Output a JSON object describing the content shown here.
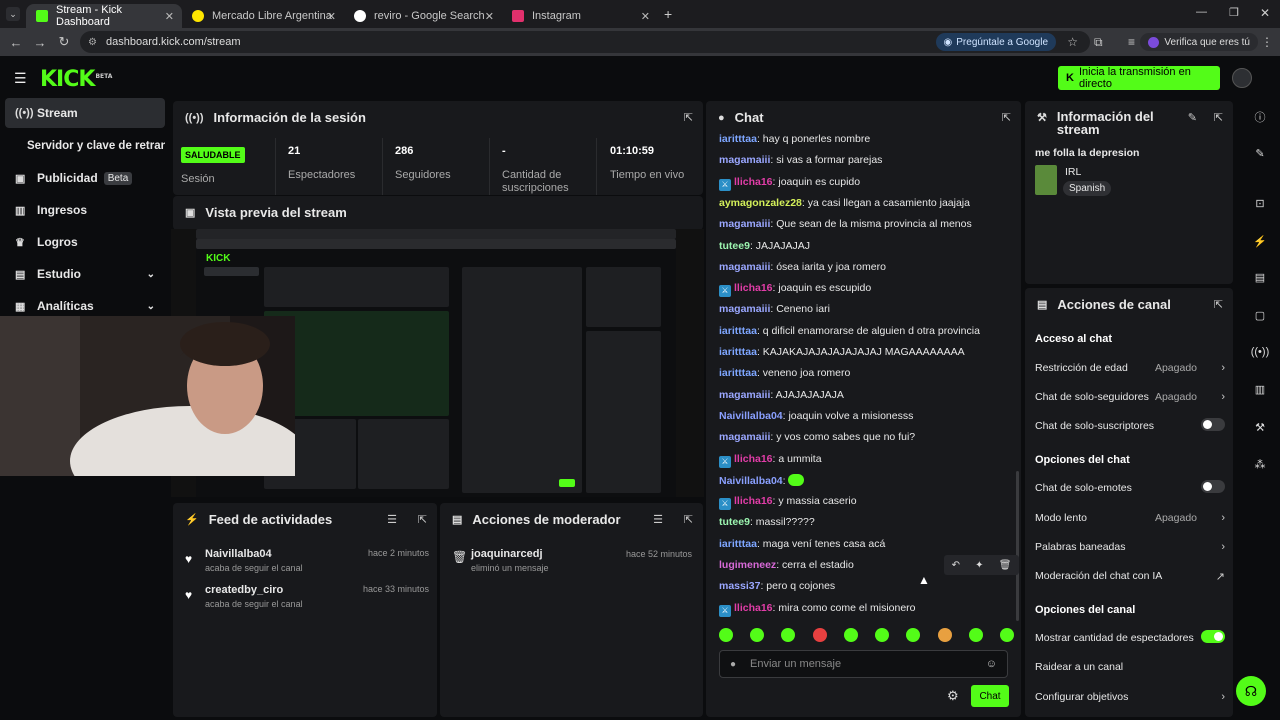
{
  "browser": {
    "tabs": [
      {
        "label": "Stream - Kick Dashboard"
      },
      {
        "label": "Mercado Libre Argentina - Envi"
      },
      {
        "label": "reviro - Google Search"
      },
      {
        "label": "Instagram"
      }
    ],
    "url": "dashboard.kick.com/stream",
    "ask_google": "Pregúntale a Google",
    "verify": "Verifica que eres tú"
  },
  "header": {
    "logo": "KICK",
    "logo_badge": "BETA",
    "go_live": "Inicia la transmisión en directo"
  },
  "sidebar": {
    "items": [
      {
        "label": "Stream"
      },
      {
        "label": "Servidor y clave de retransn"
      },
      {
        "label": "Publicidad",
        "badge": "Beta"
      },
      {
        "label": "Ingresos"
      },
      {
        "label": "Logros"
      },
      {
        "label": "Estudio"
      },
      {
        "label": "Analíticas"
      }
    ]
  },
  "session": {
    "title": "Información de la sesión",
    "status": "SALUDABLE",
    "status_label": "Sesión",
    "viewers": "21",
    "viewers_label": "Espectadores",
    "followers": "286",
    "followers_label": "Seguidores",
    "subs": "-",
    "subs_label": "Cantidad de suscripciones",
    "uptime": "01:10:59",
    "uptime_label": "Tiempo en vivo"
  },
  "preview": {
    "title": "Vista previa del stream"
  },
  "activity": {
    "title": "Feed de actividades",
    "items": [
      {
        "user": "Naivillalba04",
        "action": "acaba de seguir el canal",
        "time": "hace 2 minutos"
      },
      {
        "user": "createdby_ciro",
        "action": "acaba de seguir el canal",
        "time": "hace 33 minutos"
      }
    ]
  },
  "moderator": {
    "title": "Acciones de moderador",
    "items": [
      {
        "user": "joaquinarcedj",
        "action": "eliminó un mensaje",
        "time": "hace 52 minutos"
      }
    ]
  },
  "chat": {
    "title": "Chat",
    "messages": [
      {
        "user": "iaritttaa",
        "text": "hay q ponerles nombre",
        "color": "#7ea6ff",
        "badge": false
      },
      {
        "user": "magamaiii",
        "text": "si vas a formar parejas",
        "color": "#9aa7ff",
        "badge": false
      },
      {
        "user": "llicha16",
        "text": "joaquin es cupido",
        "color": "#e23da8",
        "badge": true
      },
      {
        "user": "aymagonzalez28",
        "text": "ya casi llegan a casamiento jaajaja",
        "color": "#d4f05a",
        "badge": false
      },
      {
        "user": "magamaiii",
        "text": "Que sean de la misma provincia al menos",
        "color": "#9aa7ff",
        "badge": false
      },
      {
        "user": "tutee9",
        "text": "JAJAJAJAJ",
        "color": "#9cf5b0",
        "badge": false
      },
      {
        "user": "magamaiii",
        "text": "ósea iarita y joa romero",
        "color": "#9aa7ff",
        "badge": false
      },
      {
        "user": "llicha16",
        "text": "joaquin es escupido",
        "color": "#e23da8",
        "badge": true
      },
      {
        "user": "magamaiii",
        "text": "Ceneno iari",
        "color": "#9aa7ff",
        "badge": false
      },
      {
        "user": "iaritttaa",
        "text": "q dificil enamorarse de alguien d otra provincia",
        "color": "#7ea6ff",
        "badge": false
      },
      {
        "user": "iaritttaa",
        "text": "KAJAKAJAJAJAJAJAJAJ MAGAAAAAAAA",
        "color": "#7ea6ff",
        "badge": false
      },
      {
        "user": "iaritttaa",
        "text": "veneno joa romero",
        "color": "#7ea6ff",
        "badge": false
      },
      {
        "user": "magamaiii",
        "text": "AJAJAJAJAJA",
        "color": "#9aa7ff",
        "badge": false
      },
      {
        "user": "Naivillalba04",
        "text": "joaquin volve a misionesss",
        "color": "#8aa0ff",
        "badge": false
      },
      {
        "user": "magamaiii",
        "text": "y vos como sabes que no fui?",
        "color": "#9aa7ff",
        "badge": false
      },
      {
        "user": "llicha16",
        "text": "a ummita",
        "color": "#e23da8",
        "badge": true
      },
      {
        "user": "Naivillalba04",
        "text": "",
        "color": "#8aa0ff",
        "badge": false
      },
      {
        "user": "llicha16",
        "text": "y massia caserio",
        "color": "#e23da8",
        "badge": true
      },
      {
        "user": "tutee9",
        "text": "massil?????",
        "color": "#9cf5b0",
        "badge": false
      },
      {
        "user": "iaritttaa",
        "text": "maga vení tenes casa acá",
        "color": "#7ea6ff",
        "badge": false
      },
      {
        "user": "lugimeneez",
        "text": "cerra el estadio",
        "color": "#d86ad8",
        "badge": false
      },
      {
        "user": "massi37",
        "text": "pero q cojones",
        "color": "#9aa7ff",
        "badge": false
      },
      {
        "user": "llicha16",
        "text": "mira como come el misionero",
        "color": "#e23da8",
        "badge": true
      }
    ],
    "input_placeholder": "Enviar un mensaje",
    "send": "Chat"
  },
  "stream_info": {
    "title": "Información del stream",
    "stream_title": "me folla la depresion",
    "category": "IRL",
    "language": "Spanish"
  },
  "channel_actions": {
    "title": "Acciones de canal",
    "chat_access": "Acceso al chat",
    "age": "Restricción de edad",
    "age_val": "Apagado",
    "followers_only": "Chat de solo-seguidores",
    "followers_val": "Apagado",
    "subs_only": "Chat de solo-suscriptores",
    "chat_options": "Opciones del chat",
    "emotes_only": "Chat de solo-emotes",
    "slow": "Modo lento",
    "slow_val": "Apagado",
    "banned": "Palabras baneadas",
    "ai_mod": "Moderación del chat con IA",
    "channel_options": "Opciones del canal",
    "show_viewers": "Mostrar cantidad de espectadores",
    "raid": "Raidear a un canal",
    "goals": "Configurar objetivos"
  },
  "colors": {
    "accent": "#53fc18",
    "panel": "#18191c",
    "bg": "#0b0c0e"
  }
}
